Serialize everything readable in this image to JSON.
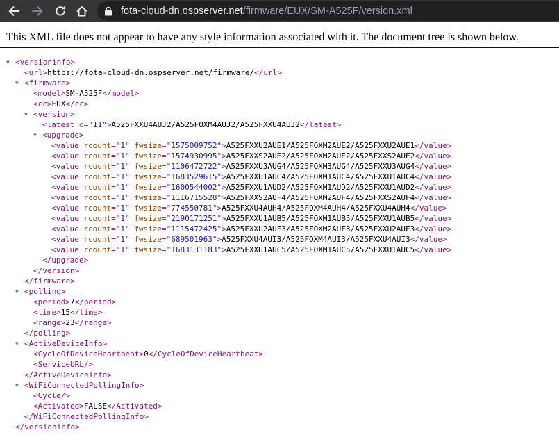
{
  "browser": {
    "url_host": "fota-cloud-dn.ospserver.net",
    "url_path": "/firmware/EUX/SM-A525F/version.xml"
  },
  "notice": "This XML file does not appear to have any style information associated with it. The document tree is shown below.",
  "tree": {
    "url": "https://fota-cloud-dn.ospserver.net/firmware/",
    "model": "SM-A525F",
    "cc": "EUX",
    "latest": {
      "o": "11",
      "text": "A525FXXU4AUJ2/A525FOXM4AUJ2/A525FXXU4AUJ2"
    },
    "upgrade": [
      {
        "rcount": "1",
        "fwsize": "1575009752",
        "text": "A525FXXU2AUE1/A525FOXM2AUE2/A525FXXU2AUE1"
      },
      {
        "rcount": "1",
        "fwsize": "1574930995",
        "text": "A525FXXS2AUE2/A525FOXM2AUE2/A525FXXS2AUE2"
      },
      {
        "rcount": "1",
        "fwsize": "1106472722",
        "text": "A525FXXU3AUG4/A525FOXM3AUG4/A525FXXU3AUG4"
      },
      {
        "rcount": "1",
        "fwsize": "1683529615",
        "text": "A525FXXU1AUC4/A525FOXM1AUC4/A525FXXU1AUC4"
      },
      {
        "rcount": "1",
        "fwsize": "1600544002",
        "text": "A525FXXU1AUD2/A525FOXM1AUD2/A525FXXU1AUD2"
      },
      {
        "rcount": "1",
        "fwsize": "1116715528",
        "text": "A525FXXS2AUF4/A525FOXM2AUF4/A525FXXS2AUF4"
      },
      {
        "rcount": "1",
        "fwsize": "774550781",
        "text": "A525FXXU4AUH4/A525FOXM4AUH4/A525FXXU4AUH4"
      },
      {
        "rcount": "1",
        "fwsize": "2190171251",
        "text": "A525FXXU1AUB5/A525FOXM1AUB5/A525FXXU1AUB5"
      },
      {
        "rcount": "1",
        "fwsize": "1115472425",
        "text": "A525FXXU2AUF3/A525FOXM2AUF3/A525FXXU2AUF3"
      },
      {
        "rcount": "1",
        "fwsize": "689501963",
        "text": "A525FXXU4AUI3/A525FOXM4AUI3/A525FXXU4AUI3"
      },
      {
        "rcount": "1",
        "fwsize": "1683131183",
        "text": "A525FXXU1AUC5/A525FOXM1AUC5/A525FXXU1AUC5"
      }
    ],
    "polling": {
      "period": "7",
      "time": "15",
      "range": "23"
    },
    "heartbeat": "0",
    "activated": "FALSE"
  }
}
